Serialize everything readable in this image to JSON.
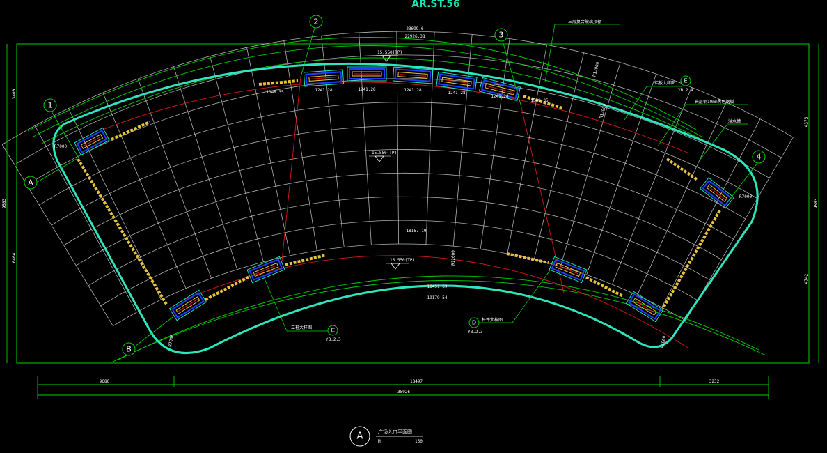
{
  "sheet": {
    "header_label": "AR.ST.56",
    "title_block": {
      "bubble": "A",
      "title": "广场入口平面图",
      "scale_left": "M",
      "scale_right": "150"
    }
  },
  "axis_bubbles": [
    "1",
    "2",
    "3",
    "4",
    "A",
    "B"
  ],
  "callouts": {
    "top_note": "三层复合玻璃顶棚",
    "e_label": "铝板大样图",
    "e_bubble": "E",
    "e_ref": "YB.2.4",
    "glass_note": "夹层钢10mm黑色钢板",
    "water_note": "溢水槽",
    "c_label": "立柱大样图",
    "c_bubble": "C",
    "c_ref": "YB.2.3",
    "d_label": "杆件大样图",
    "d_bubble": "D",
    "d_ref": "YB.2.3"
  },
  "radius_labels": [
    "R7000",
    "R7000",
    "R7000",
    "R7000"
  ],
  "elevations": [
    "15.550(TP)",
    "15.550(TP)",
    "15.550(TP)"
  ],
  "dimensions": {
    "overall_bottom": "35926",
    "segment_left": "9680",
    "segment_mid": "18497",
    "segment_right": "3232",
    "top_arc": "23699.6",
    "top_arc_inner": "22926.38",
    "left_total": "9583",
    "left_part_a": "3400",
    "left_part_b": "6464",
    "right_total": "9583",
    "right_part_a": "4375",
    "right_part_b": "4742",
    "inner_arc": "18157.19",
    "bottom_arc": "19179.54",
    "bottom_arc_inner": "18451.69",
    "radius_left": "R12000",
    "radius_right": "R12000",
    "radius_mid": "R12000"
  },
  "top_segment_dims": [
    "1348.35",
    "1241.28",
    "1241.28",
    "1241.28",
    "1241.28",
    "1241.28",
    "1348.35"
  ],
  "colors": {
    "background": "#000000",
    "slab_edge": "#2ee6bd",
    "grid": "#cfcfcf",
    "dimension": "#00d000",
    "axis": "#d81818",
    "glass_panel": "#1f3cff",
    "bench": "#e6c43a"
  }
}
